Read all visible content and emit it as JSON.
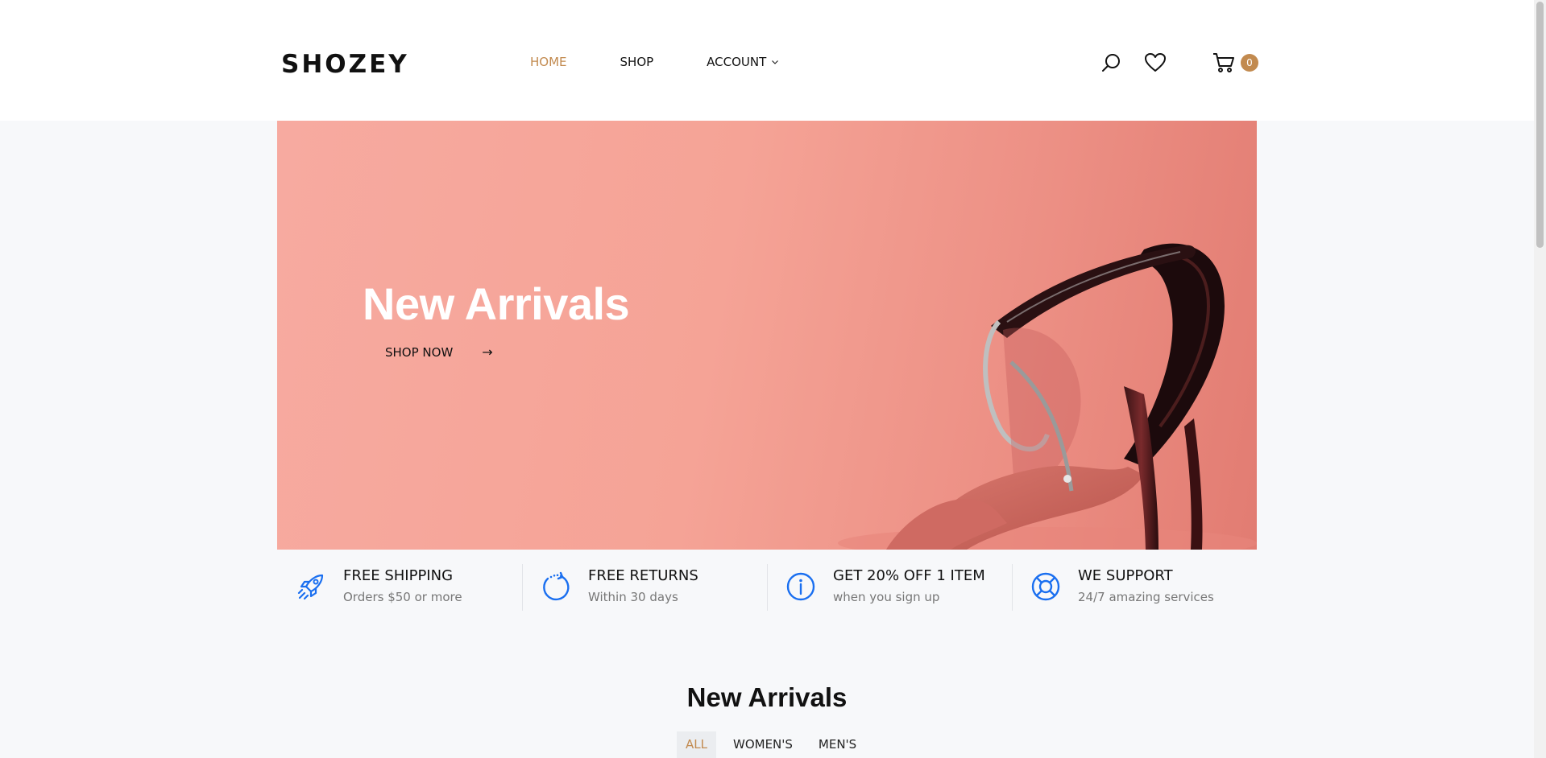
{
  "header": {
    "logo": "SHOZEY",
    "nav": [
      {
        "label": "HOME",
        "active": true
      },
      {
        "label": "SHOP",
        "active": false
      },
      {
        "label": "ACCOUNT",
        "active": false,
        "has_dropdown": true
      }
    ],
    "icons": [
      "search-icon",
      "heart-icon",
      "cart-icon"
    ],
    "cart_count": "0"
  },
  "hero": {
    "title": "New Arrivals",
    "button_label": "SHOP NOW",
    "button_arrow": "→"
  },
  "features": [
    {
      "icon": "rocket-icon",
      "title": "FREE SHIPPING",
      "subtitle": "Orders $50 or more"
    },
    {
      "icon": "returns-icon",
      "title": "FREE RETURNS",
      "subtitle": "Within 30 days"
    },
    {
      "icon": "info-icon",
      "title": "GET 20% OFF 1 ITEM",
      "subtitle": "when you sign up"
    },
    {
      "icon": "lifebuoy-icon",
      "title": "WE SUPPORT",
      "subtitle": "24/7 amazing services"
    }
  ],
  "section": {
    "title": "New Arrivals",
    "filters": [
      {
        "label": "ALL",
        "active": true
      },
      {
        "label": "WOMEN'S",
        "active": false
      },
      {
        "label": "MEN'S",
        "active": false
      }
    ]
  },
  "colors": {
    "accent": "#c28a4f",
    "icon_blue": "#1a6ff0",
    "hero_pink": "#f5a396"
  }
}
